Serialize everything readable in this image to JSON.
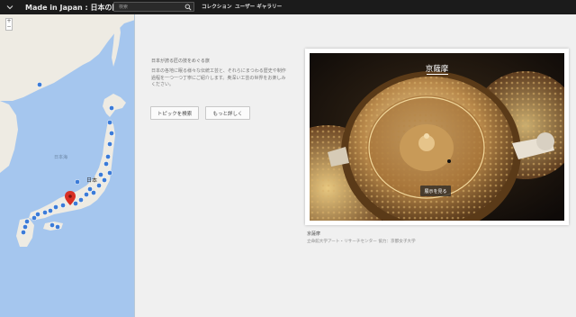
{
  "header": {
    "title": "Made in Japan : 日本の匠",
    "search_placeholder": "検索",
    "nav": [
      "コレクション",
      "ユーザー ギャラリー"
    ]
  },
  "map": {
    "label_country": "日本",
    "label_sea": "日本海",
    "zoom_plus": "+",
    "zoom_minus": "−"
  },
  "info": {
    "heading": "日本が誇る匠の技をめぐる旅",
    "description": "日本の各地に眠る様々な伝統工芸と、それらにまつわる歴史や制作過程を一つ一つ丁寧にご紹介します。奥深い工芸の世界をお楽しみください。",
    "buttons": [
      "トピックを検索",
      "もっと詳しく"
    ]
  },
  "featured": {
    "title": "京薩摩",
    "view_button": "展示を見る",
    "caption_title": "京薩摩",
    "caption_credit": "立命館大学アート・リサーチセンター 協力：京都女子大学"
  },
  "colors": {
    "topbar": "#1b1b1b",
    "sea": "#a5c6ee",
    "land": "#eeebe3",
    "marker": "#3b7bd8",
    "pin": "#d93025"
  }
}
